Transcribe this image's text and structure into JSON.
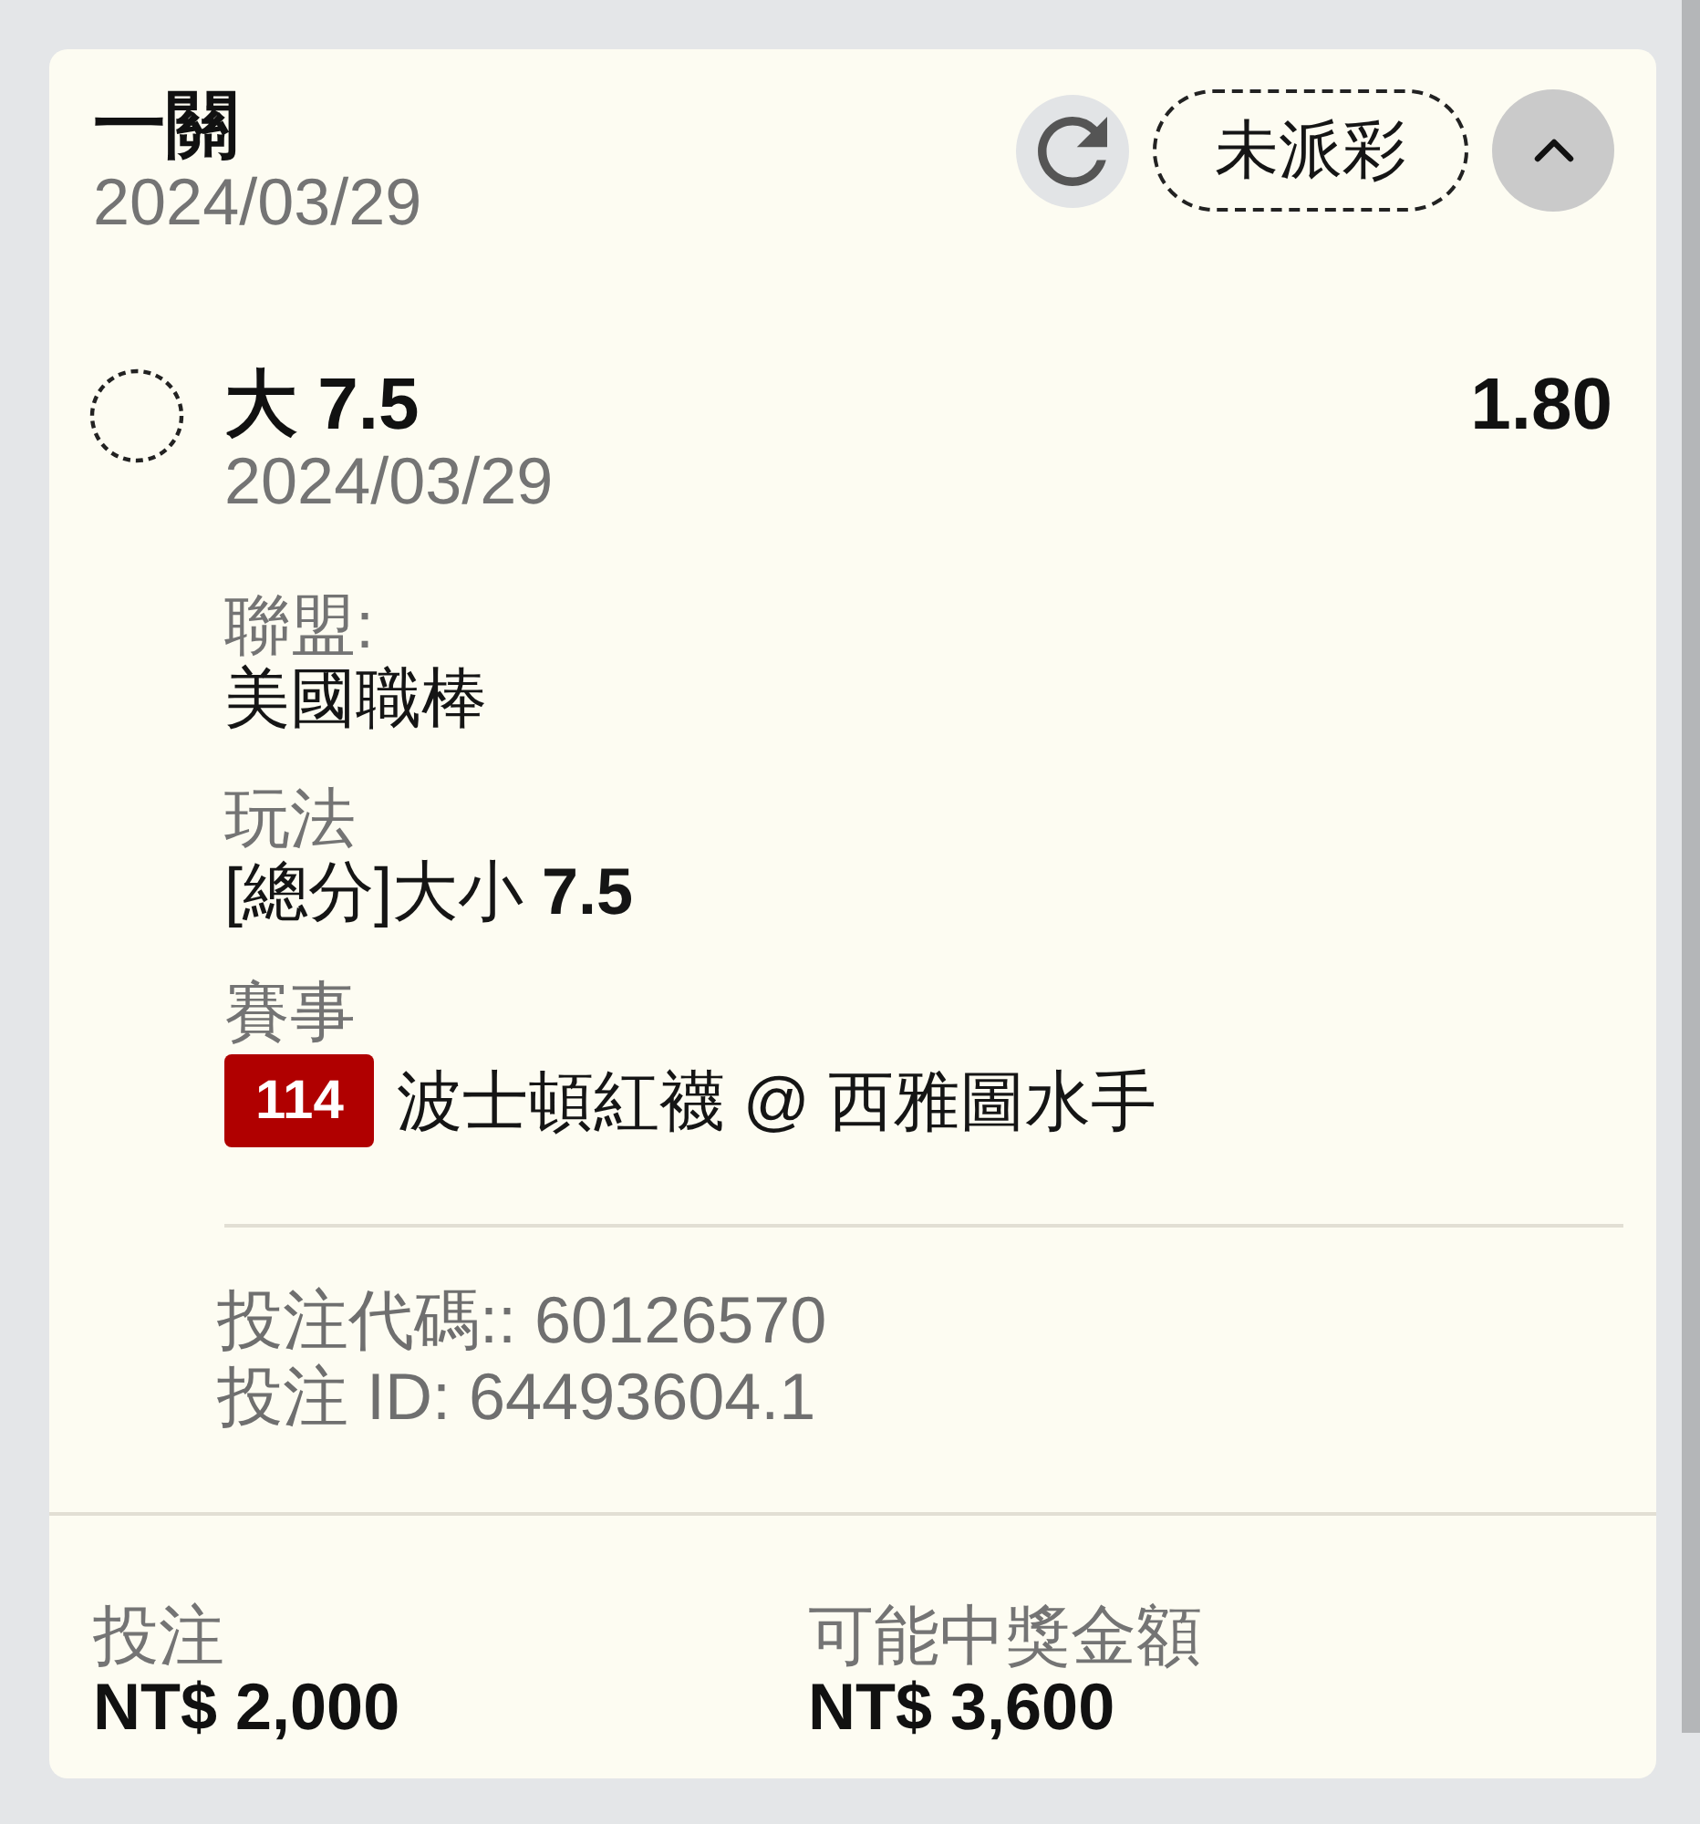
{
  "bet": {
    "title": "一關",
    "date": "2024/03/29",
    "status": "未派彩",
    "expanded": true
  },
  "selection": {
    "name": "大 7.5",
    "odds": "1.80",
    "date": "2024/03/29"
  },
  "details": [
    {
      "label": "聯盟:",
      "value": "美國職棒"
    },
    {
      "label": "玩法",
      "value": "[總分]大小 **7.5**"
    },
    {
      "label": "賽事",
      "value": "波士頓紅襪 @ 西雅圖水手",
      "tag": "114"
    }
  ],
  "references": [
    "投注代碼:: 60126570",
    "投注 ID: 64493604.1"
  ],
  "totals": [
    {
      "label": "投注",
      "amount": "NT$ 2,000"
    },
    {
      "label": "可能中獎金額",
      "amount": "NT$ 3,600"
    }
  ]
}
